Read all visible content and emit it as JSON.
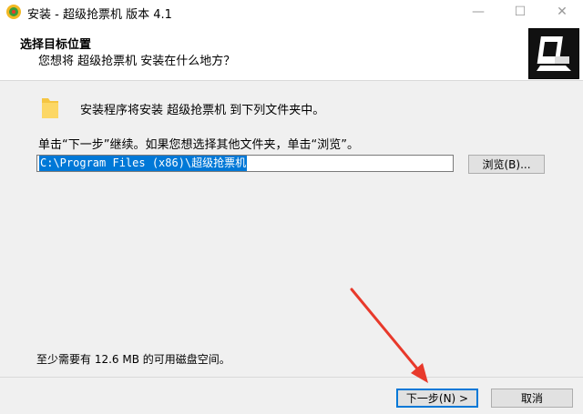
{
  "window": {
    "title": "安装 - 超级抢票机 版本 4.1",
    "minimize_glyph": "—",
    "maximize_glyph": "☐",
    "close_glyph": "✕"
  },
  "header": {
    "title": "选择目标位置",
    "subtitle": "您想将 超级抢票机 安装在什么地方？"
  },
  "body": {
    "intro": "安装程序将安装 超级抢票机 到下列文件夹中。",
    "instruction": "单击“下一步”继续。如果您想选择其他文件夹，单击“浏览”。",
    "install_path": "C:\\Program Files (x86)\\超级抢票机",
    "browse_label": "浏览(B)...",
    "space_required": "至少需要有 12.6 MB 的可用磁盘空间。"
  },
  "footer": {
    "next_label": "下一步(N) >",
    "cancel_label": "取消"
  },
  "colors": {
    "accent": "#0078d7",
    "annotation_arrow": "#e8392b"
  },
  "icons": [
    "app-icon",
    "installer-logo-icon",
    "folder-icon"
  ]
}
